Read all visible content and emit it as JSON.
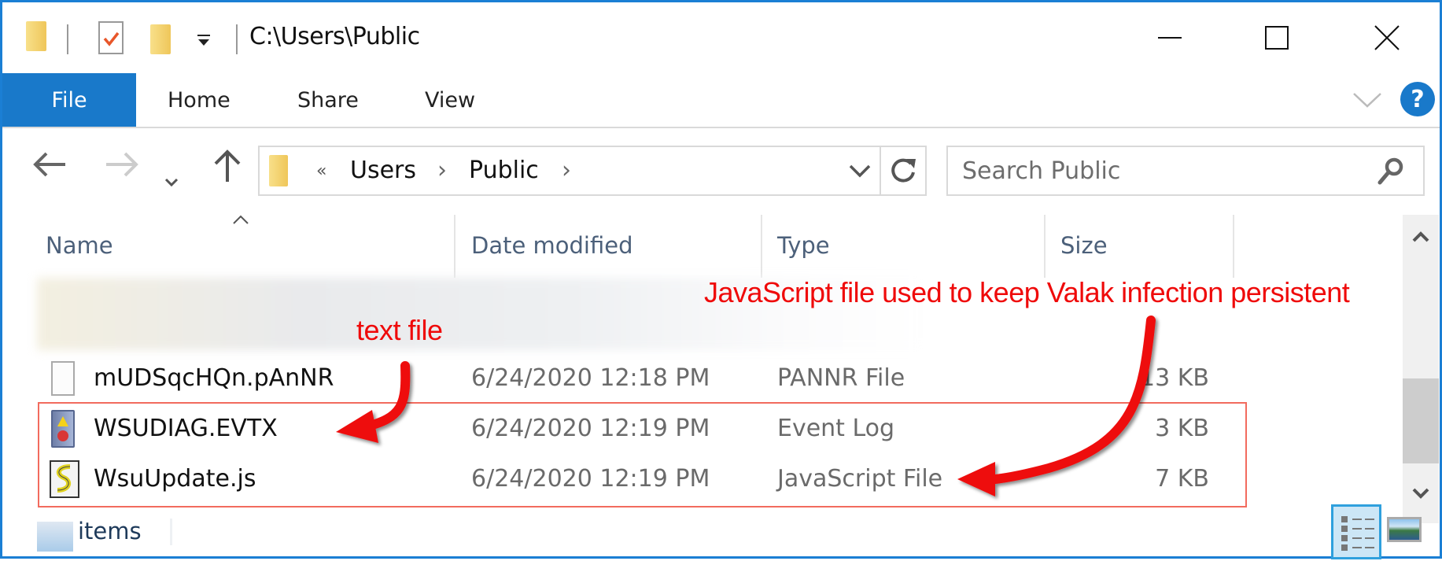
{
  "window": {
    "title": "C:\\Users\\Public",
    "accent_color": "#1979ca"
  },
  "quick_access": {
    "icons": [
      "folder-icon",
      "properties-icon",
      "new-folder-icon",
      "customize-dropdown-icon"
    ]
  },
  "window_controls": {
    "minimize": "minimize",
    "maximize": "maximize",
    "close": "close"
  },
  "ribbon": {
    "tabs": [
      {
        "label": "File",
        "active": true
      },
      {
        "label": "Home"
      },
      {
        "label": "Share"
      },
      {
        "label": "View"
      }
    ],
    "help_label": "?"
  },
  "navigation": {
    "back": "←",
    "forward": "→",
    "recent": "⌄",
    "up": "↑",
    "address": {
      "overflow": "«",
      "crumbs": [
        "Users",
        "Public"
      ],
      "separator": "›"
    },
    "search_placeholder": "Search Public"
  },
  "file_list": {
    "columns": [
      "Name",
      "Date modified",
      "Type",
      "Size"
    ],
    "sort_column": "Name",
    "rows": [
      {
        "name": "mUDSqcHQn.pAnNR",
        "date": "6/24/2020 12:18 PM",
        "type": "PANNR File",
        "size": "13 KB",
        "icon": "blank-file-icon"
      },
      {
        "name": "WSUDIAG.EVTX",
        "date": "6/24/2020 12:19 PM",
        "type": "Event Log",
        "size": "3 KB",
        "icon": "event-log-icon"
      },
      {
        "name": "WsuUpdate.js",
        "date": "6/24/2020 12:19 PM",
        "type": "JavaScript File",
        "size": "7 KB",
        "icon": "javascript-file-icon"
      }
    ]
  },
  "annotations": {
    "text_file": "text file",
    "javascript": "JavaScript file used to keep Valak infection persistent",
    "color": "#ef0a0a"
  },
  "status_bar": {
    "items": "items"
  }
}
